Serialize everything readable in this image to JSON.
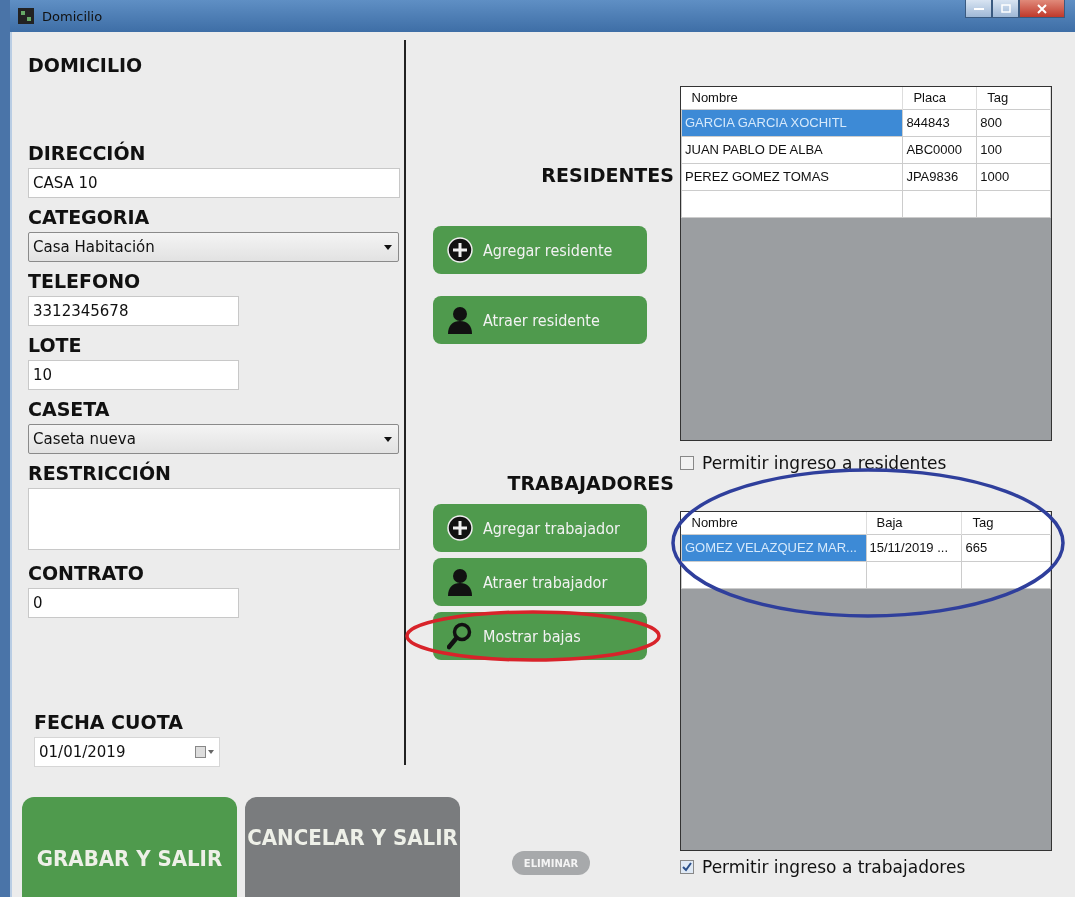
{
  "window": {
    "title": "Domicilio"
  },
  "form": {
    "heading": "DOMICILIO",
    "fields": [
      {
        "kind": "line",
        "label": "DIRECCIÓN",
        "value": "CASA 10"
      },
      {
        "kind": "select",
        "label": "CATEGORIA",
        "value": "Casa Habitación"
      },
      {
        "kind": "short",
        "label": "TELEFONO",
        "value": "3312345678"
      },
      {
        "kind": "short",
        "label": "LOTE",
        "value": "10"
      },
      {
        "kind": "select",
        "label": "CASETA",
        "value": "Caseta nueva"
      },
      {
        "kind": "area",
        "label": "RESTRICCIÓN"
      },
      {
        "kind": "short",
        "label": "CONTRATO",
        "value": "0"
      }
    ],
    "date": {
      "label": "FECHA CUOTA",
      "value": "01/01/2019"
    }
  },
  "residents": {
    "heading": "RESIDENTES",
    "actions": [
      {
        "kind": "add",
        "label": "Agregar residente"
      },
      {
        "kind": "attract",
        "label": "Atraer residente"
      }
    ],
    "columns": [
      "Nombre",
      "Placa",
      "Tag"
    ],
    "rows": [
      {
        "cells": [
          "GARCIA GARCIA XOCHITL",
          "844843",
          "800"
        ],
        "selected": true
      },
      {
        "cells": [
          "JUAN PABLO DE ALBA",
          "ABC0000",
          "100"
        ],
        "selected": false
      },
      {
        "cells": [
          "PEREZ GOMEZ TOMAS",
          "JPA9836",
          "1000"
        ],
        "selected": false
      }
    ],
    "checkbox": {
      "label": "Permitir ingreso a residentes",
      "checked": false
    }
  },
  "workers": {
    "heading": "TRABAJADORES",
    "circled": true,
    "actions": [
      {
        "kind": "add",
        "label": "Agregar trabajador",
        "circled": false
      },
      {
        "kind": "attract",
        "label": "Atraer trabajador",
        "circled": false
      },
      {
        "kind": "search",
        "label": "Mostrar bajas",
        "circled": true
      }
    ],
    "columns": [
      "Nombre",
      "Baja",
      "Tag"
    ],
    "rows": [
      {
        "cells": [
          "GOMEZ VELAZQUEZ MAR...",
          "15/11/2019 ...",
          "665"
        ],
        "selected": true
      }
    ],
    "checkbox": {
      "label": "Permitir ingreso a trabajadores",
      "checked": true
    }
  },
  "bottom_buttons": [
    {
      "kind": "primary",
      "label": "GRABAR Y SALIR"
    },
    {
      "kind": "secondary",
      "label": "CANCELAR Y SALIR"
    },
    {
      "kind": "small",
      "label": "ELIMINAR"
    }
  ]
}
